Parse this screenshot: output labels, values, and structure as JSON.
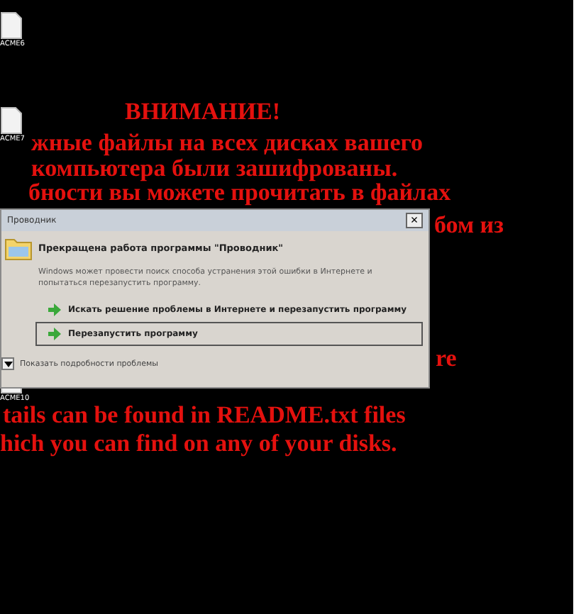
{
  "desktop_icons": [
    {
      "label": "ACME6"
    },
    {
      "label": "ACME7"
    },
    {
      "label": "ACME10"
    }
  ],
  "message_lines": [
    "ВНИМАНИЕ!",
    "жные файлы на всех дисках вашего",
    "компьютера были зашифрованы.",
    "бности вы можете прочитать в файлах",
    "бом из",
    "re",
    "tails can be found in README.txt files",
    "hich you can find on any of your disks."
  ],
  "dialog": {
    "title": "Проводник",
    "close": "×",
    "heading": "Прекращена работа программы \"Проводник\"",
    "body": "Windows может провести поиск способа устранения этой ошибки в Интернете и попытаться перезапустить программу.",
    "options": [
      {
        "label": "Искать решение проблемы в Интернете и перезапустить программу",
        "selected": false
      },
      {
        "label": "Перезапустить программу",
        "selected": true
      }
    ],
    "details": "Показать подробности проблемы"
  }
}
